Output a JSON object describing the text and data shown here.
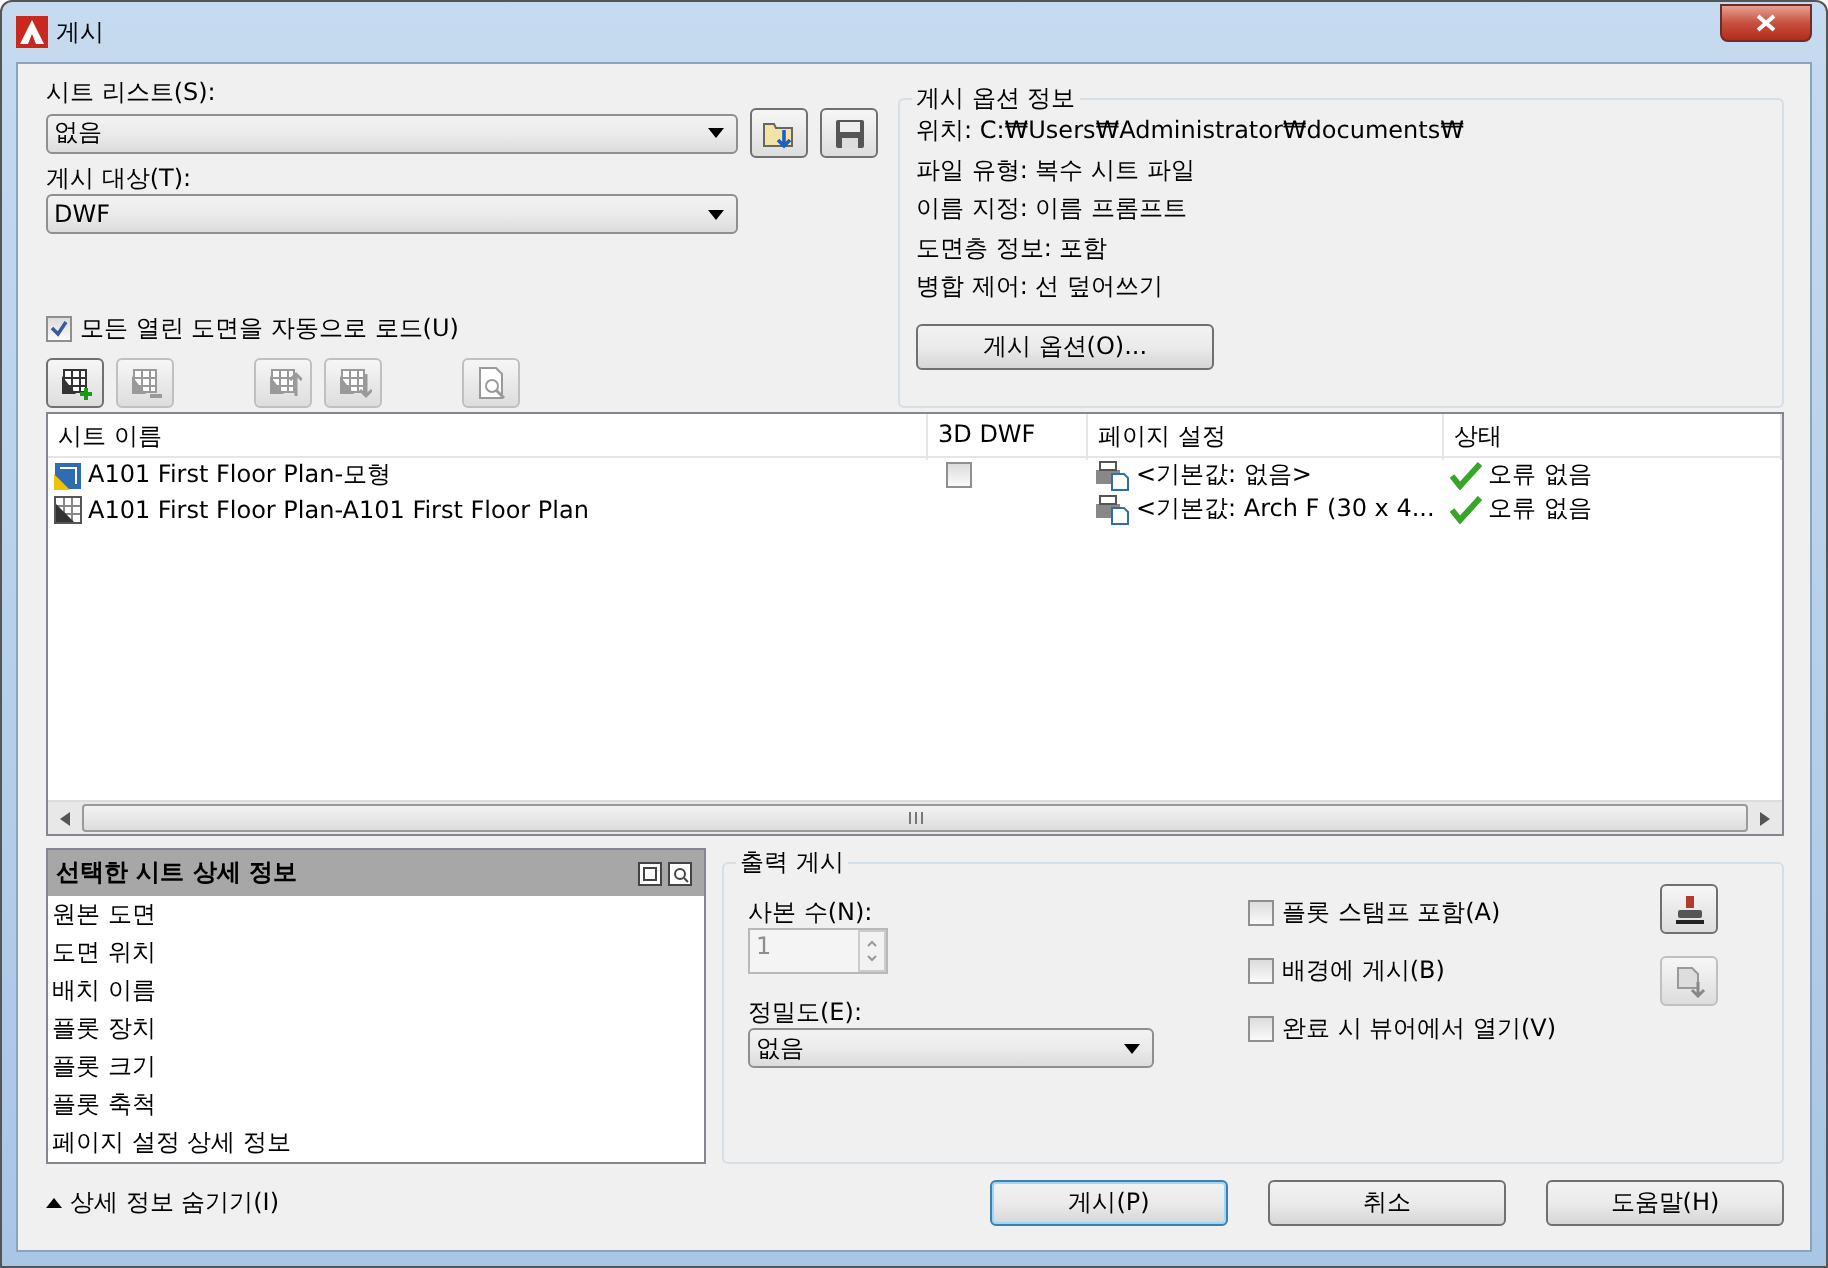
{
  "window": {
    "title": "게시"
  },
  "sheet_list": {
    "label": "시트 리스트(S):",
    "value": "없음"
  },
  "publish_to": {
    "label": "게시 대상(T):",
    "value": "DWF"
  },
  "auto_load": {
    "label": "모든 열린 도면을 자동으로 로드(U)",
    "checked": true
  },
  "toolbar": [
    {
      "kind": "add",
      "disabled": false
    },
    {
      "kind": "remove",
      "disabled": true
    },
    {
      "kind": "up",
      "disabled": true
    },
    {
      "kind": "down",
      "disabled": true
    },
    {
      "kind": "preview",
      "disabled": true
    }
  ],
  "options_info": {
    "title": "게시 옵션 정보",
    "lines": [
      "위치: C:₩Users₩Administrator₩documents₩",
      "파일 유형: 복수 시트 파일",
      "이름 지정: 이름 프롬프트",
      "도면층 정보: 포함",
      "병합 제어: 선 덮어쓰기"
    ],
    "button": "게시 옵션(O)..."
  },
  "table": {
    "columns": [
      "시트 이름",
      "3D DWF",
      "페이지 설정",
      "상태"
    ],
    "rows": [
      {
        "kind": "model",
        "name": "A101 First Floor Plan-모형",
        "dwf_3d": {
          "checked": false
        },
        "page_setup": "<기본값: 없음>",
        "status": "오류 없음"
      },
      {
        "kind": "layout",
        "name": "A101 First Floor Plan-A101 First Floor Plan",
        "page_setup": "<기본값: Arch F (30 x 4...",
        "status": "오류 없음"
      }
    ]
  },
  "details": {
    "title": "선택한 시트 상세 정보",
    "items": [
      "원본 도면",
      "도면 위치",
      "배치 이름",
      "플롯 장치",
      "플롯 크기",
      "플롯 축척",
      "페이지 설정 상세 정보"
    ]
  },
  "output": {
    "title": "출력 게시",
    "copies_label": "사본 수(N):",
    "copies_value": "1",
    "copies_disabled": true,
    "precision_label": "정밀도(E):",
    "precision_value": "없음",
    "options": [
      {
        "label": "플롯 스탬프 포함(A)",
        "checked": false
      },
      {
        "label": "배경에 게시(B)",
        "checked": false
      },
      {
        "label": "완료 시 뷰어에서 열기(V)",
        "checked": false
      }
    ]
  },
  "hide_details": "상세 정보 숨기기(I)",
  "buttons": [
    {
      "label": "게시(P)",
      "default": true
    },
    {
      "label": "취소",
      "default": false
    },
    {
      "label": "도움말(H)",
      "default": false
    }
  ]
}
